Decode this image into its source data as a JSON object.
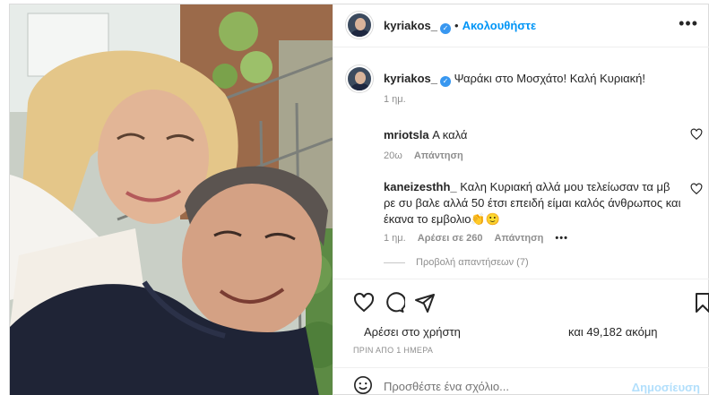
{
  "post": {
    "username": "kyriakos_",
    "follow_label": "Ακολουθήστε",
    "caption": "Ψαράκι στο Μοσχάτο! Καλή Κυριακή!",
    "caption_age": "1 ημ."
  },
  "comments": [
    {
      "username": "mriotsla",
      "text": "Α καλά",
      "age": "20ω",
      "reply_label": "Απάντηση"
    },
    {
      "username": "kaneizesthh_",
      "text": "Καλη Κυριακή αλλά μου τελείωσαν τα μβ ρε συ βαλε αλλά 50 έτσι επειδή είμαι καλός άνθρωπος και έκανα το εμβολιο👏🙂",
      "age": "1 ημ.",
      "likes_label": "Αρέσει σε 260",
      "reply_label": "Απάντηση",
      "view_replies": "Προβολή απαντήσεων (7)"
    }
  ],
  "likes": {
    "text": "Αρέσει στο χρήστη",
    "count_text": "και 49,182 ακόμη"
  },
  "timestamp": "ΠΡΙΝ ΑΠΟ 1 ΗΜΕΡΑ",
  "comment_box": {
    "placeholder": "Προσθέστε ένα σχόλιο...",
    "post_label": "Δημοσίευση"
  },
  "icons": {
    "heart": "heart-icon",
    "comment": "comment-icon",
    "share": "share-icon",
    "save": "bookmark-icon",
    "emoji": "emoji-icon",
    "more": "more-options-icon"
  },
  "colors": {
    "link_blue": "#0095f6",
    "post_disabled": "#b2dffc",
    "muted": "#8e8e8e",
    "verified": "#3897f0"
  }
}
